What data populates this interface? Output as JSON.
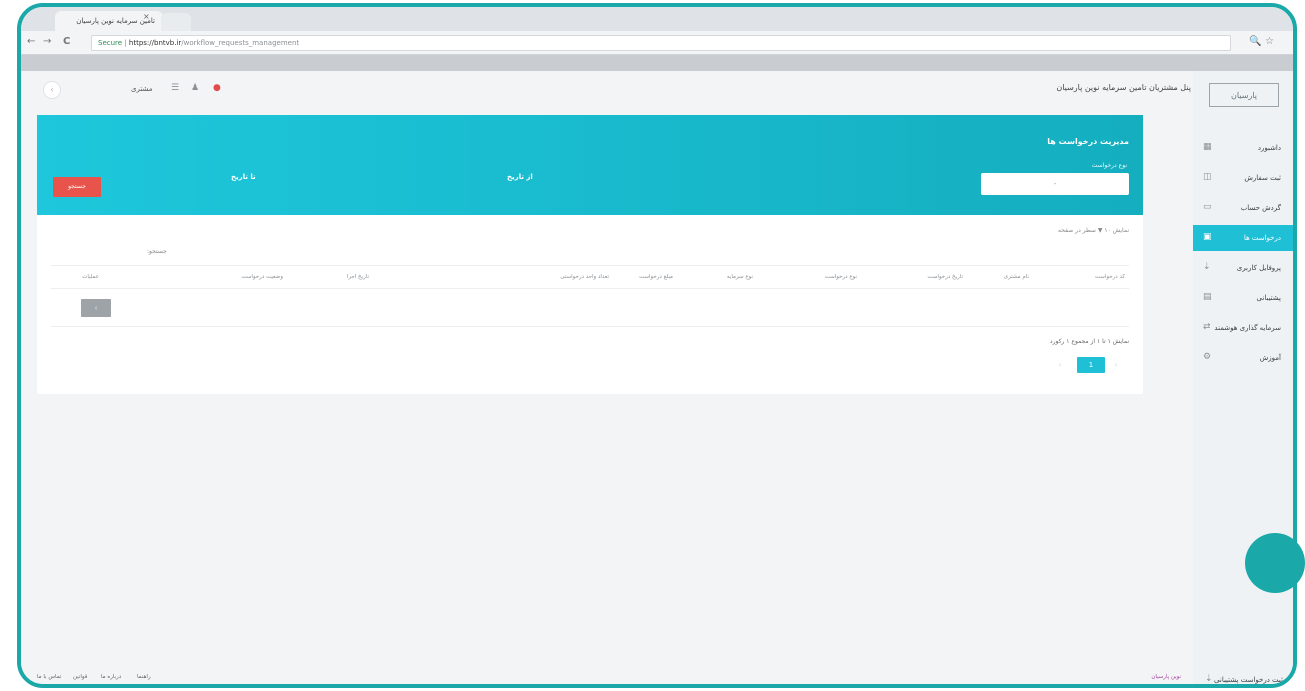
{
  "browser": {
    "tab_title": "تامین سرمایه نوین پارسیان",
    "tab_close": "×",
    "back": "←",
    "forward": "→",
    "reload": "C",
    "secure_label": "Secure",
    "url_host": "https://bntvb.ir",
    "url_path": "/workflow_requests_management",
    "zoom_icon": "🔍",
    "star_icon": "☆"
  },
  "sidebar": {
    "logo_text": "پارسیان",
    "items": [
      {
        "label": "داشبورد",
        "icon": "▦",
        "active": false
      },
      {
        "label": "ثبت سفارش",
        "icon": "◫",
        "active": false
      },
      {
        "label": "گردش حساب",
        "icon": "▭",
        "active": false
      },
      {
        "label": "درخواست ها",
        "icon": "▣",
        "active": true
      },
      {
        "label": "پروفایل کاربری",
        "icon": "⇣",
        "active": false
      },
      {
        "label": "پشتیبانی",
        "icon": "▤",
        "active": false
      },
      {
        "label": "سرمایه گذاری هوشمند",
        "icon": "⇄",
        "active": false
      },
      {
        "label": "آموزش",
        "icon": "⚙",
        "active": false
      }
    ],
    "bottom_item": {
      "label": "ثبت درخواست پشتیبانی",
      "icon": "⇣"
    }
  },
  "topbar": {
    "site_title": "پنل مشتریان تامین سرمایه نوین پارسیان",
    "user_name": "مشتری",
    "menu_icon": "☰",
    "user_icon": "♟",
    "bell_icon": "●",
    "collapse_icon": "‹"
  },
  "banner": {
    "title": "مدیریت درخواست ها",
    "select_label": "نوع درخواست",
    "select_value": "-",
    "date_from_label": "از تاریخ",
    "date_to_label": "تا تاریخ",
    "search_button": "جستجو"
  },
  "filter": {
    "text": "نمایش ۱۰ ▼ سطر در صفحه",
    "search_label": "جستجو:"
  },
  "table": {
    "columns": [
      "کد درخواست",
      "نام مشتری",
      "تاریخ درخواست",
      "نوع درخواست",
      "نوع سرمایه",
      "مبلغ درخواست",
      "تعداد واحد درخواستی",
      "تاریخ اجرا",
      "وضعیت درخواست",
      "عملیات"
    ],
    "empty_button": "‹"
  },
  "pagination": {
    "info": "نمایش ۱ تا ۱ از مجموع ۱ رکورد",
    "current": "1",
    "prev": "›",
    "next": "‹"
  },
  "footer": {
    "links": [
      "تماس با ما",
      "قوانین",
      "درباره ما",
      "راهنما"
    ],
    "brand": "نوین پارسیان"
  }
}
